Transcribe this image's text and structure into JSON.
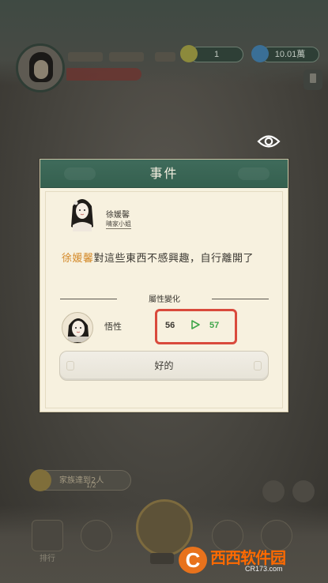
{
  "background": {
    "coins_value": "1",
    "gems_value": "10.01萬",
    "task_text": "家族達到2人",
    "task_progress": "1/2",
    "nav_labels": [
      "排行",
      "",
      ""
    ]
  },
  "dialog": {
    "title": "事件",
    "character": {
      "name": "徐媛馨",
      "seal_text": "晴家小姐"
    },
    "message": {
      "highlight_name": "徐媛馨",
      "text": "對這些東西不感興趣，自行離開了"
    },
    "section_label": "屬性變化",
    "attribute": {
      "name": "悟性",
      "old_value": "56",
      "new_value": "57"
    },
    "ok_label": "好的"
  },
  "watermark": {
    "main_text": "西西软件园",
    "sub_text": "CR173.com"
  },
  "colors": {
    "header_green": "#3f6b5b",
    "highlight_orange": "#d48a2a",
    "increase_green": "#3fa64a",
    "box_red": "#d94a3c",
    "watermark_orange": "#ff6a00"
  }
}
